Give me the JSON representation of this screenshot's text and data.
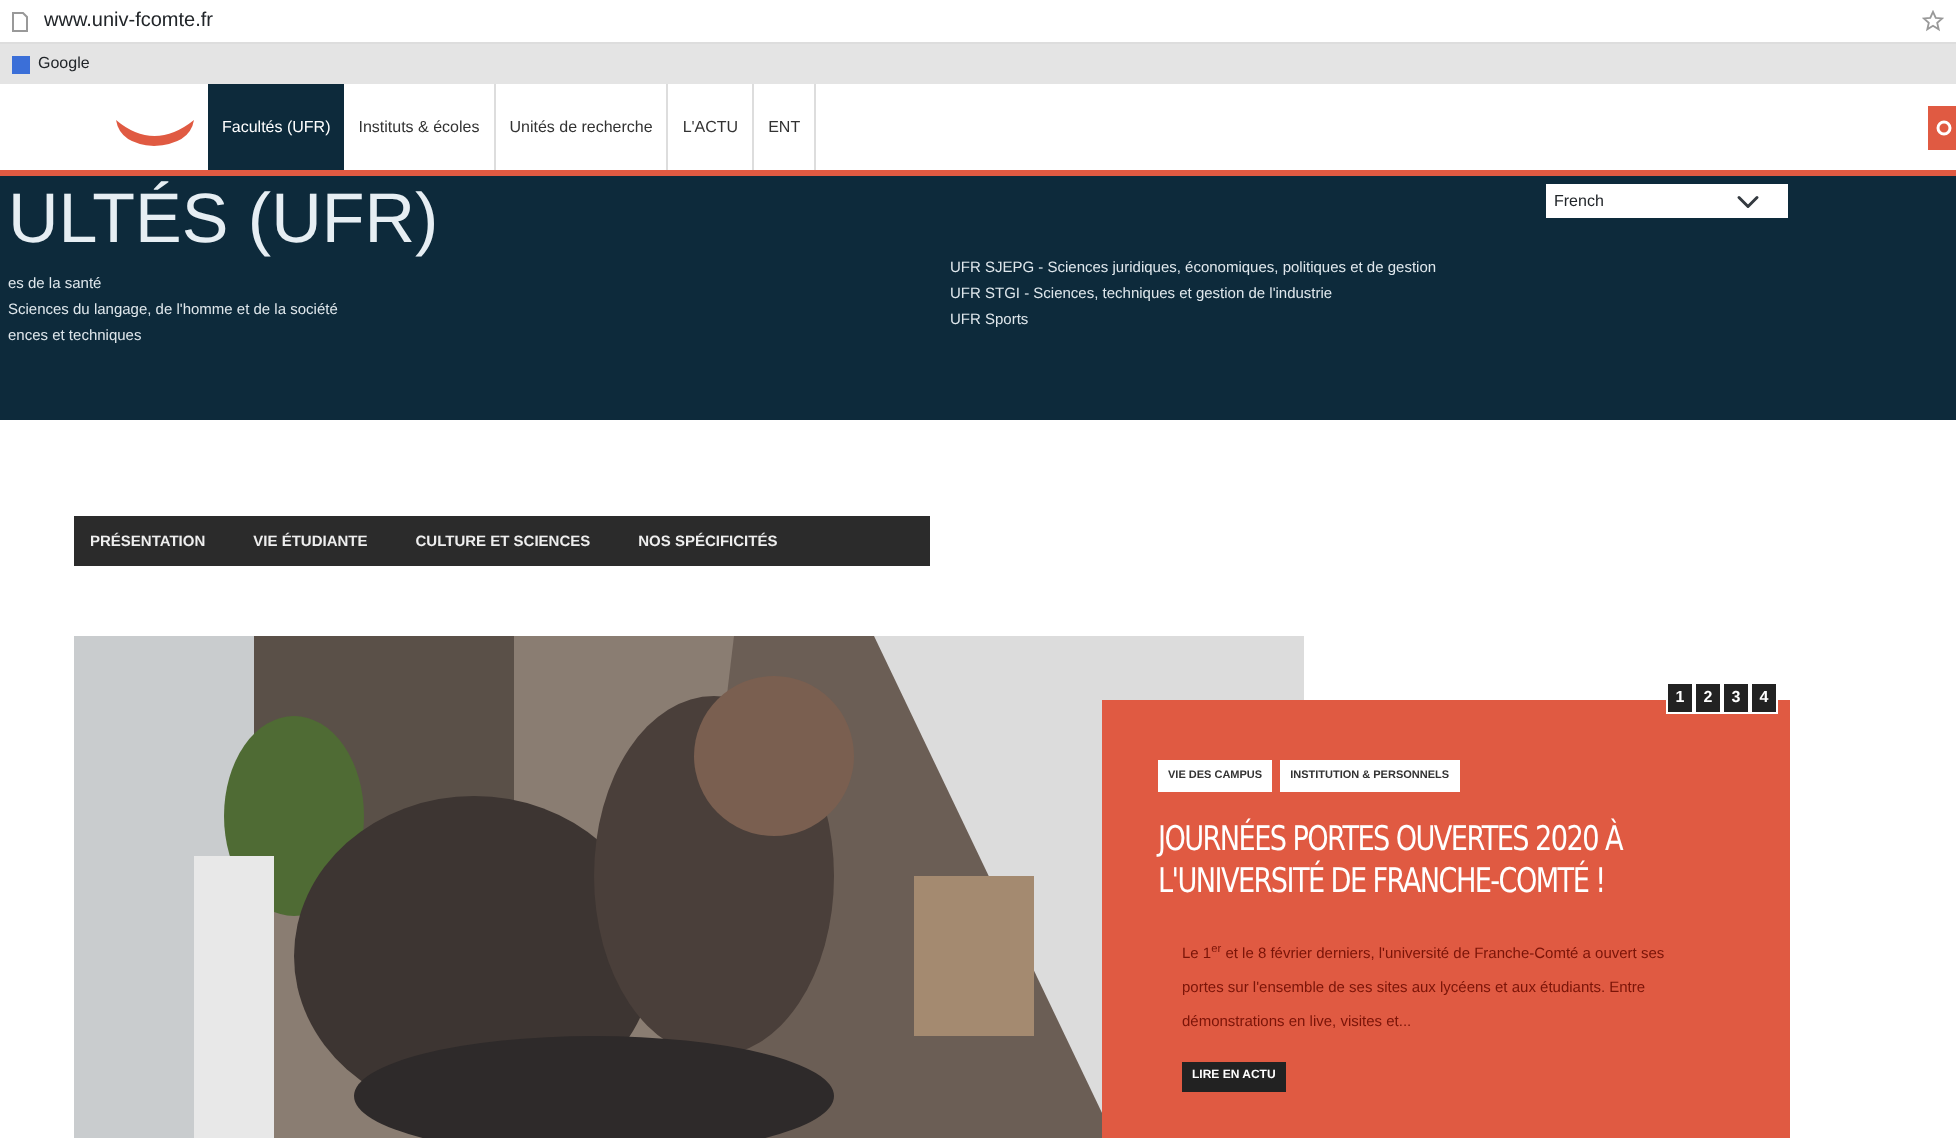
{
  "browser": {
    "url": "www.univ-fcomte.fr",
    "bookmarks": [
      "Google"
    ]
  },
  "header": {
    "nav": [
      {
        "label": "Facultés (UFR)",
        "selected": true
      },
      {
        "label": "Instituts & écoles",
        "selected": false
      },
      {
        "label": "Unités de recherche",
        "selected": false
      },
      {
        "label": "L'ACTU",
        "selected": false
      },
      {
        "label": "ENT",
        "selected": false
      }
    ]
  },
  "banner": {
    "title": "ULTÉS (UFR)",
    "language": "French",
    "links_left": [
      "es de la santé",
      "Sciences du langage, de l'homme et de la société",
      "ences et techniques"
    ],
    "links_right": [
      "UFR SJEPG - Sciences juridiques, économiques, politiques et de gestion",
      "UFR STGI - Sciences, techniques et gestion de l'industrie",
      "UFR Sports"
    ]
  },
  "subnav": [
    "PRÉSENTATION",
    "VIE ÉTUDIANTE",
    "CULTURE ET SCIENCES",
    "NOS SPÉCIFICITÉS"
  ],
  "slider": {
    "pages": [
      "1",
      "2",
      "3",
      "4"
    ],
    "tags": [
      "VIE DES CAMPUS",
      "INSTITUTION & PERSONNELS"
    ],
    "title": "JOURNÉES PORTES OUVERTES 2020 À L'UNIVERSITÉ DE FRANCHE-COMTÉ !",
    "text": "Le 1$^{er}$ et le 8 février derniers, l'université de Franche-Comté a ouvert ses portes sur l'ensemble de ses sites aux lycéens et aux étudiants. Entre démonstrations en live, visites et...",
    "button": "LIRE EN ACTU"
  }
}
